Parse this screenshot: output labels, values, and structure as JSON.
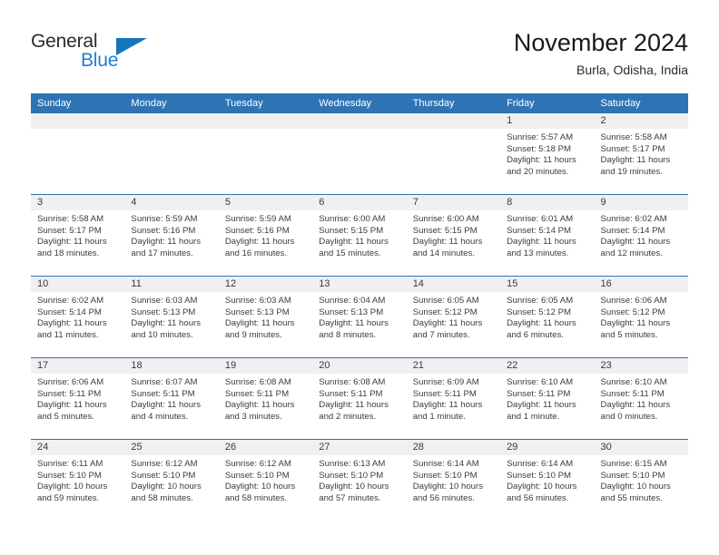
{
  "brand": {
    "name_part1": "General",
    "name_part2": "Blue",
    "triangle_icon": "triangle-icon",
    "colors": {
      "dark": "#2b2b2b",
      "blue": "#1c7fd0",
      "triangle": "#1675bc"
    }
  },
  "header": {
    "title": "November 2024",
    "subtitle": "Burla, Odisha, India"
  },
  "theme": {
    "header_blue": "#2e74b5",
    "daynum_band": "#f0f0f0",
    "text": "#3c3c3c"
  },
  "calendar": {
    "weekdays": [
      "Sunday",
      "Monday",
      "Tuesday",
      "Wednesday",
      "Thursday",
      "Friday",
      "Saturday"
    ],
    "weeks": [
      [
        {
          "day": "",
          "sunrise": "",
          "sunset": "",
          "daylight": ""
        },
        {
          "day": "",
          "sunrise": "",
          "sunset": "",
          "daylight": ""
        },
        {
          "day": "",
          "sunrise": "",
          "sunset": "",
          "daylight": ""
        },
        {
          "day": "",
          "sunrise": "",
          "sunset": "",
          "daylight": ""
        },
        {
          "day": "",
          "sunrise": "",
          "sunset": "",
          "daylight": ""
        },
        {
          "day": "1",
          "sunrise": "Sunrise: 5:57 AM",
          "sunset": "Sunset: 5:18 PM",
          "daylight": "Daylight: 11 hours and 20 minutes."
        },
        {
          "day": "2",
          "sunrise": "Sunrise: 5:58 AM",
          "sunset": "Sunset: 5:17 PM",
          "daylight": "Daylight: 11 hours and 19 minutes."
        }
      ],
      [
        {
          "day": "3",
          "sunrise": "Sunrise: 5:58 AM",
          "sunset": "Sunset: 5:17 PM",
          "daylight": "Daylight: 11 hours and 18 minutes."
        },
        {
          "day": "4",
          "sunrise": "Sunrise: 5:59 AM",
          "sunset": "Sunset: 5:16 PM",
          "daylight": "Daylight: 11 hours and 17 minutes."
        },
        {
          "day": "5",
          "sunrise": "Sunrise: 5:59 AM",
          "sunset": "Sunset: 5:16 PM",
          "daylight": "Daylight: 11 hours and 16 minutes."
        },
        {
          "day": "6",
          "sunrise": "Sunrise: 6:00 AM",
          "sunset": "Sunset: 5:15 PM",
          "daylight": "Daylight: 11 hours and 15 minutes."
        },
        {
          "day": "7",
          "sunrise": "Sunrise: 6:00 AM",
          "sunset": "Sunset: 5:15 PM",
          "daylight": "Daylight: 11 hours and 14 minutes."
        },
        {
          "day": "8",
          "sunrise": "Sunrise: 6:01 AM",
          "sunset": "Sunset: 5:14 PM",
          "daylight": "Daylight: 11 hours and 13 minutes."
        },
        {
          "day": "9",
          "sunrise": "Sunrise: 6:02 AM",
          "sunset": "Sunset: 5:14 PM",
          "daylight": "Daylight: 11 hours and 12 minutes."
        }
      ],
      [
        {
          "day": "10",
          "sunrise": "Sunrise: 6:02 AM",
          "sunset": "Sunset: 5:14 PM",
          "daylight": "Daylight: 11 hours and 11 minutes."
        },
        {
          "day": "11",
          "sunrise": "Sunrise: 6:03 AM",
          "sunset": "Sunset: 5:13 PM",
          "daylight": "Daylight: 11 hours and 10 minutes."
        },
        {
          "day": "12",
          "sunrise": "Sunrise: 6:03 AM",
          "sunset": "Sunset: 5:13 PM",
          "daylight": "Daylight: 11 hours and 9 minutes."
        },
        {
          "day": "13",
          "sunrise": "Sunrise: 6:04 AM",
          "sunset": "Sunset: 5:13 PM",
          "daylight": "Daylight: 11 hours and 8 minutes."
        },
        {
          "day": "14",
          "sunrise": "Sunrise: 6:05 AM",
          "sunset": "Sunset: 5:12 PM",
          "daylight": "Daylight: 11 hours and 7 minutes."
        },
        {
          "day": "15",
          "sunrise": "Sunrise: 6:05 AM",
          "sunset": "Sunset: 5:12 PM",
          "daylight": "Daylight: 11 hours and 6 minutes."
        },
        {
          "day": "16",
          "sunrise": "Sunrise: 6:06 AM",
          "sunset": "Sunset: 5:12 PM",
          "daylight": "Daylight: 11 hours and 5 minutes."
        }
      ],
      [
        {
          "day": "17",
          "sunrise": "Sunrise: 6:06 AM",
          "sunset": "Sunset: 5:11 PM",
          "daylight": "Daylight: 11 hours and 5 minutes."
        },
        {
          "day": "18",
          "sunrise": "Sunrise: 6:07 AM",
          "sunset": "Sunset: 5:11 PM",
          "daylight": "Daylight: 11 hours and 4 minutes."
        },
        {
          "day": "19",
          "sunrise": "Sunrise: 6:08 AM",
          "sunset": "Sunset: 5:11 PM",
          "daylight": "Daylight: 11 hours and 3 minutes."
        },
        {
          "day": "20",
          "sunrise": "Sunrise: 6:08 AM",
          "sunset": "Sunset: 5:11 PM",
          "daylight": "Daylight: 11 hours and 2 minutes."
        },
        {
          "day": "21",
          "sunrise": "Sunrise: 6:09 AM",
          "sunset": "Sunset: 5:11 PM",
          "daylight": "Daylight: 11 hours and 1 minute."
        },
        {
          "day": "22",
          "sunrise": "Sunrise: 6:10 AM",
          "sunset": "Sunset: 5:11 PM",
          "daylight": "Daylight: 11 hours and 1 minute."
        },
        {
          "day": "23",
          "sunrise": "Sunrise: 6:10 AM",
          "sunset": "Sunset: 5:11 PM",
          "daylight": "Daylight: 11 hours and 0 minutes."
        }
      ],
      [
        {
          "day": "24",
          "sunrise": "Sunrise: 6:11 AM",
          "sunset": "Sunset: 5:10 PM",
          "daylight": "Daylight: 10 hours and 59 minutes."
        },
        {
          "day": "25",
          "sunrise": "Sunrise: 6:12 AM",
          "sunset": "Sunset: 5:10 PM",
          "daylight": "Daylight: 10 hours and 58 minutes."
        },
        {
          "day": "26",
          "sunrise": "Sunrise: 6:12 AM",
          "sunset": "Sunset: 5:10 PM",
          "daylight": "Daylight: 10 hours and 58 minutes."
        },
        {
          "day": "27",
          "sunrise": "Sunrise: 6:13 AM",
          "sunset": "Sunset: 5:10 PM",
          "daylight": "Daylight: 10 hours and 57 minutes."
        },
        {
          "day": "28",
          "sunrise": "Sunrise: 6:14 AM",
          "sunset": "Sunset: 5:10 PM",
          "daylight": "Daylight: 10 hours and 56 minutes."
        },
        {
          "day": "29",
          "sunrise": "Sunrise: 6:14 AM",
          "sunset": "Sunset: 5:10 PM",
          "daylight": "Daylight: 10 hours and 56 minutes."
        },
        {
          "day": "30",
          "sunrise": "Sunrise: 6:15 AM",
          "sunset": "Sunset: 5:10 PM",
          "daylight": "Daylight: 10 hours and 55 minutes."
        }
      ]
    ]
  }
}
